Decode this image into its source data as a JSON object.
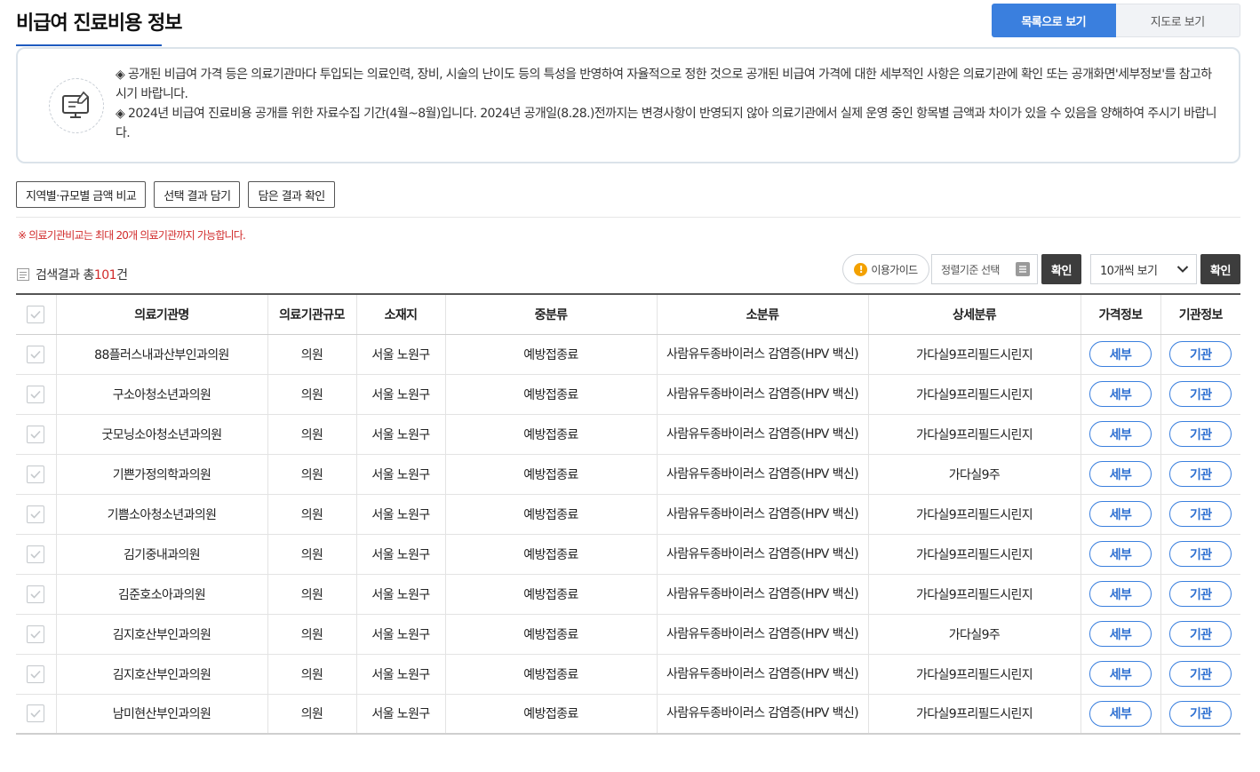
{
  "page": {
    "title": "비급여 진료비용 정보"
  },
  "view_toggle": {
    "list_label": "목록으로 보기",
    "map_label": "지도로 보기"
  },
  "notice": {
    "line1": "◈ 공개된 비급여 가격 등은 의료기관마다 투입되는 의료인력, 장비, 시술의 난이도 등의 특성을 반영하여 자율적으로 정한 것으로 공개된 비급여 가격에 대한 세부적인 사항은 의료기관에 확인 또는 공개화면'세부정보'를 참고하시기 바랍니다.",
    "line2": "◈ 2024년 비급여 진료비용 공개를 위한 자료수집 기간(4월~8월)입니다. 2024년 공개일(8.28.)전까지는 변경사항이 반영되지 않아 의료기관에서 실제 운영 중인 항목별 금액과 차이가 있을 수 있음을 양해하여 주시기 바랍니다."
  },
  "actions": {
    "compare_label": "지역별·규모별 금액 비교",
    "add_label": "선택 결과 담기",
    "view_saved_label": "담은 결과 확인"
  },
  "warning": "※ 의료기관비교는 최대 20개 의료기관까지 가능합니다.",
  "results": {
    "prefix": "검색결과 총",
    "count": "101",
    "suffix": "건"
  },
  "controls": {
    "guide_label": "이용가이드",
    "guide_badge": "!",
    "sort_placeholder": "정렬기준 선택",
    "confirm_label": "확인",
    "per_page_value": "10개씩 보기",
    "confirm2_label": "확인"
  },
  "table": {
    "headers": [
      "의료기관명",
      "의료기관규모",
      "소재지",
      "중분류",
      "소분류",
      "상세분류",
      "가격정보",
      "기관정보"
    ],
    "price_button": "세부",
    "inst_button": "기관",
    "rows": [
      {
        "name": "88플러스내과산부인과의원",
        "size": "의원",
        "location": "서울 노원구",
        "mid": "예방접종료",
        "small": "사람유두종바이러스 감염증(HPV 백신)",
        "detail": "가다실9프리필드시린지"
      },
      {
        "name": "구소아청소년과의원",
        "size": "의원",
        "location": "서울 노원구",
        "mid": "예방접종료",
        "small": "사람유두종바이러스 감염증(HPV 백신)",
        "detail": "가다실9프리필드시린지"
      },
      {
        "name": "굿모닝소아청소년과의원",
        "size": "의원",
        "location": "서울 노원구",
        "mid": "예방접종료",
        "small": "사람유두종바이러스 감염증(HPV 백신)",
        "detail": "가다실9프리필드시린지"
      },
      {
        "name": "기쁜가정의학과의원",
        "size": "의원",
        "location": "서울 노원구",
        "mid": "예방접종료",
        "small": "사람유두종바이러스 감염증(HPV 백신)",
        "detail": "가다실9주"
      },
      {
        "name": "기쁨소아청소년과의원",
        "size": "의원",
        "location": "서울 노원구",
        "mid": "예방접종료",
        "small": "사람유두종바이러스 감염증(HPV 백신)",
        "detail": "가다실9프리필드시린지"
      },
      {
        "name": "김기중내과의원",
        "size": "의원",
        "location": "서울 노원구",
        "mid": "예방접종료",
        "small": "사람유두종바이러스 감염증(HPV 백신)",
        "detail": "가다실9프리필드시린지"
      },
      {
        "name": "김준호소아과의원",
        "size": "의원",
        "location": "서울 노원구",
        "mid": "예방접종료",
        "small": "사람유두종바이러스 감염증(HPV 백신)",
        "detail": "가다실9프리필드시린지"
      },
      {
        "name": "김지호산부인과의원",
        "size": "의원",
        "location": "서울 노원구",
        "mid": "예방접종료",
        "small": "사람유두종바이러스 감염증(HPV 백신)",
        "detail": "가다실9주"
      },
      {
        "name": "김지호산부인과의원",
        "size": "의원",
        "location": "서울 노원구",
        "mid": "예방접종료",
        "small": "사람유두종바이러스 감염증(HPV 백신)",
        "detail": "가다실9프리필드시린지"
      },
      {
        "name": "남미현산부인과의원",
        "size": "의원",
        "location": "서울 노원구",
        "mid": "예방접종료",
        "small": "사람유두종바이러스 감염증(HPV 백신)",
        "detail": "가다실9프리필드시린지"
      }
    ]
  },
  "colors": {
    "primary": "#3a7fde",
    "warning": "#d12b2b",
    "dark_button": "#3d3d3d"
  }
}
